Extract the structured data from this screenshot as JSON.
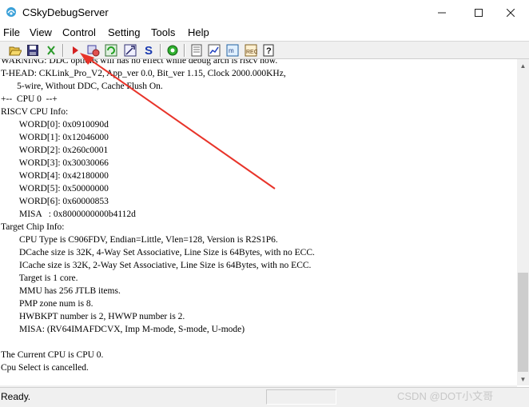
{
  "window": {
    "title": "CSkyDebugServer"
  },
  "menu": {
    "items": [
      "File",
      "View",
      "Control",
      "Setting",
      "Tools",
      "Help"
    ]
  },
  "toolbar": {
    "buttons": [
      "open-icon",
      "save-icon",
      "stop-icon",
      "run-icon",
      "config-icon",
      "refresh-icon",
      "plugin-icon",
      "script-icon",
      "target-icon",
      "doc-icon",
      "chart-icon",
      "memory-icon",
      "register-icon",
      "help-icon"
    ]
  },
  "console": {
    "lines": [
      "WARNING: DDC options will has no effect while debug arch is riscv now.",
      "T-HEAD: CKLink_Pro_V2, App_ver 0.0, Bit_ver 1.15, Clock 2000.000KHz,",
      "       5-wire, Without DDC, Cache Flush On.",
      "+--  CPU 0  --+",
      "RISCV CPU Info:",
      "        WORD[0]: 0x0910090d",
      "        WORD[1]: 0x12046000",
      "        WORD[2]: 0x260c0001",
      "        WORD[3]: 0x30030066",
      "        WORD[4]: 0x42180000",
      "        WORD[5]: 0x50000000",
      "        WORD[6]: 0x60000853",
      "        MISA   : 0x8000000000b4112d",
      "Target Chip Info:",
      "        CPU Type is C906FDV, Endian=Little, Vlen=128, Version is R2S1P6.",
      "        DCache size is 32K, 4-Way Set Associative, Line Size is 64Bytes, with no ECC.",
      "        ICache size is 32K, 2-Way Set Associative, Line Size is 64Bytes, with no ECC.",
      "        Target is 1 core.",
      "        MMU has 256 JTLB items.",
      "        PMP zone num is 8.",
      "        HWBKPT number is 2, HWWP number is 2.",
      "        MISA: (RV64IMAFDCVX, Imp M-mode, S-mode, U-mode)",
      "",
      "The Current CPU is CPU 0.",
      "Cpu Select is cancelled."
    ]
  },
  "status": {
    "text": "Ready.",
    "watermark": "CSDN @DOT小文哥"
  },
  "colors": {
    "arrow": "#e8342a",
    "run_button": "#d42020"
  }
}
